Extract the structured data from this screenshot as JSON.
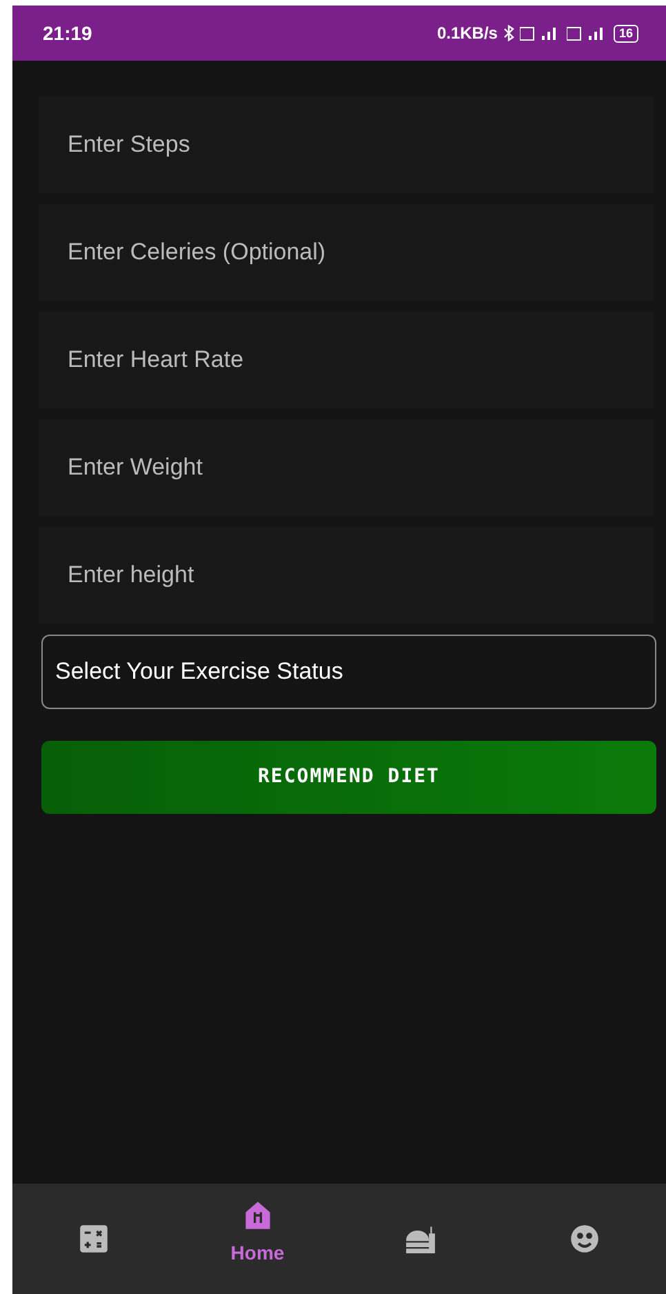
{
  "status_bar": {
    "time": "21:19",
    "speed": "0.1KB/s",
    "battery": "16"
  },
  "fields": [
    {
      "placeholder": "Enter Steps"
    },
    {
      "placeholder": "Enter Celeries (Optional)"
    },
    {
      "placeholder": "Enter Heart Rate"
    },
    {
      "placeholder": "Enter Weight"
    },
    {
      "placeholder": "Enter height"
    }
  ],
  "exercise_select": {
    "value": "Select Your Exercise Status"
  },
  "recommend_button": {
    "label": "RECOMMEND DIET"
  },
  "bottom_nav": [
    {
      "kind": "calculator",
      "selected": false
    },
    {
      "kind": "home",
      "label": "Home",
      "selected": true
    },
    {
      "kind": "food",
      "selected": false
    },
    {
      "kind": "face",
      "selected": false
    }
  ]
}
